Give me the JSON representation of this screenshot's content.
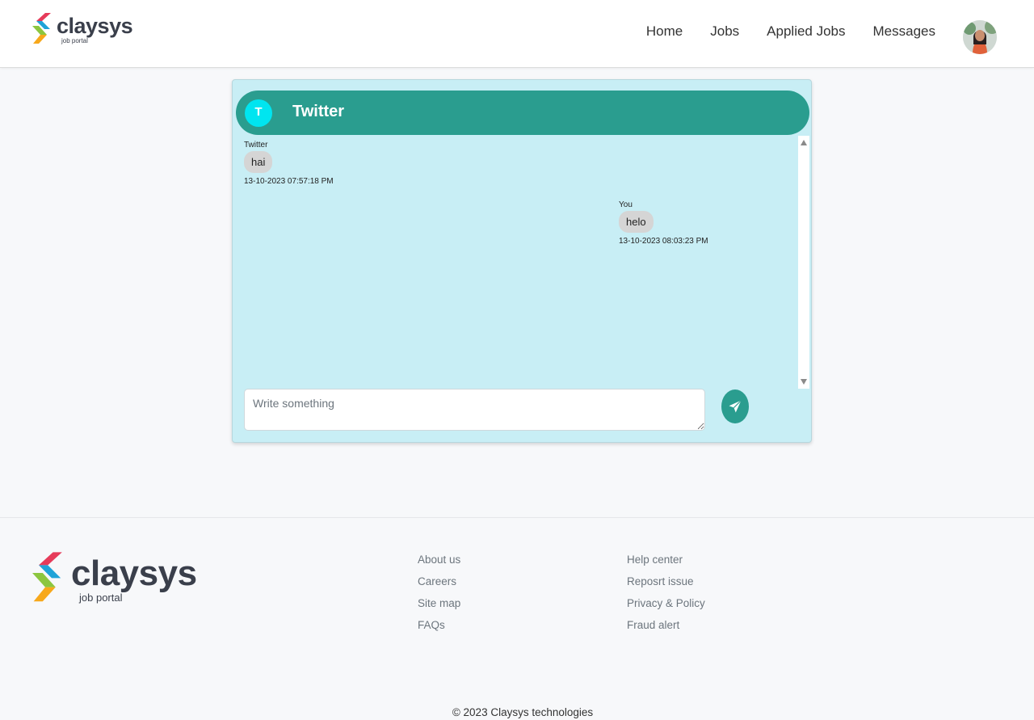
{
  "brand": {
    "name": "claysys",
    "tagline": "job portal",
    "colors": {
      "red": "#e63b5a",
      "green": "#8cc63f",
      "blue": "#1fa3d8",
      "orange": "#f7a81b",
      "text": "#3a3f4b"
    }
  },
  "nav": {
    "items": [
      {
        "label": "Home"
      },
      {
        "label": "Jobs"
      },
      {
        "label": "Applied Jobs"
      },
      {
        "label": "Messages"
      }
    ],
    "avatar_icon": "user-avatar-photo"
  },
  "chat": {
    "contact_initial": "T",
    "contact_name": "Twitter",
    "accent_color": "#2a9d8f",
    "background_color": "#c8eef5",
    "messages": [
      {
        "sender": "Twitter",
        "text": "hai",
        "time": "13-10-2023 07:57:18 PM",
        "direction": "incoming"
      },
      {
        "sender": "You",
        "text": "helo",
        "time": "13-10-2023 08:03:23 PM",
        "direction": "outgoing"
      }
    ],
    "composer": {
      "placeholder": "Write something",
      "value": ""
    },
    "send_icon": "paper-plane-icon"
  },
  "footer": {
    "col1": [
      {
        "label": "About us"
      },
      {
        "label": "Careers"
      },
      {
        "label": "Site map"
      },
      {
        "label": "FAQs"
      }
    ],
    "col2": [
      {
        "label": "Help center"
      },
      {
        "label": "Reposrt issue"
      },
      {
        "label": "Privacy & Policy"
      },
      {
        "label": "Fraud alert"
      }
    ],
    "copyright": "© 2023 Claysys technologies"
  }
}
